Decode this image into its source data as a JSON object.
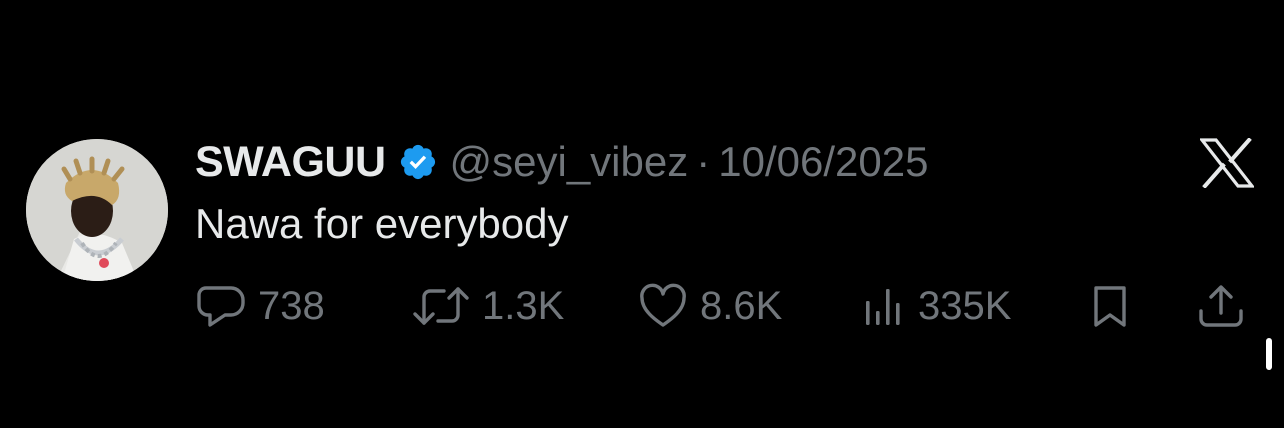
{
  "tweet": {
    "display_name": "SWAGUU",
    "handle": "@seyi_vibez",
    "separator": "·",
    "date": "10/06/2025",
    "text": "Nawa for everybody",
    "verified": true
  },
  "actions": {
    "replies": "738",
    "reposts": "1.3K",
    "likes": "8.6K",
    "views": "335K"
  },
  "icons": {
    "verified": "verified-badge-icon",
    "brand": "x-logo-icon",
    "reply": "reply-icon",
    "repost": "repost-icon",
    "like": "heart-icon",
    "views": "views-bar-chart-icon",
    "bookmark": "bookmark-icon",
    "share": "share-icon"
  },
  "colors": {
    "background": "#000000",
    "primary_text": "#e7e9ea",
    "secondary_text": "#71767b",
    "verified_blue": "#1d9bf0"
  }
}
